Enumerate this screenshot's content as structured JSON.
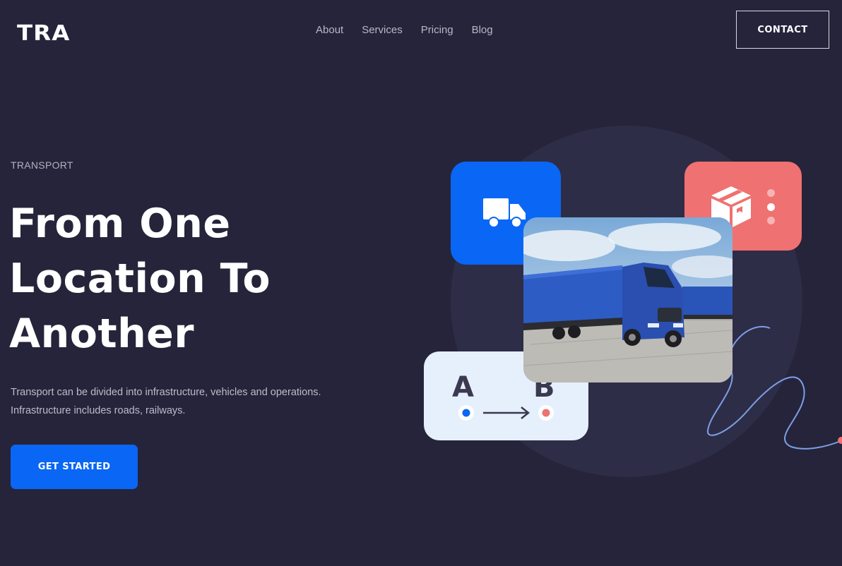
{
  "header": {
    "logo": "TRA",
    "nav": [
      "About",
      "Services",
      "Pricing",
      "Blog"
    ],
    "contact_label": "CONTACT"
  },
  "hero": {
    "eyebrow": "TRANSPORT",
    "headline": [
      "From One",
      "Location To",
      "Another"
    ],
    "description": [
      "Transport can be divided into infrastructure, vehicles and operations.",
      "Infrastructure includes roads, railways."
    ],
    "cta_label": "GET STARTED"
  },
  "visual": {
    "route_from": "A",
    "route_to": "B",
    "icons": [
      "truck-icon",
      "package-icon",
      "more-vertical-icon",
      "arrow-right-icon"
    ],
    "colors": {
      "background": "#25243a",
      "accent_blue": "#0a66f5",
      "accent_red": "#ef7171",
      "route_card": "#e6f0fd",
      "circle": "#2e2d47"
    }
  }
}
